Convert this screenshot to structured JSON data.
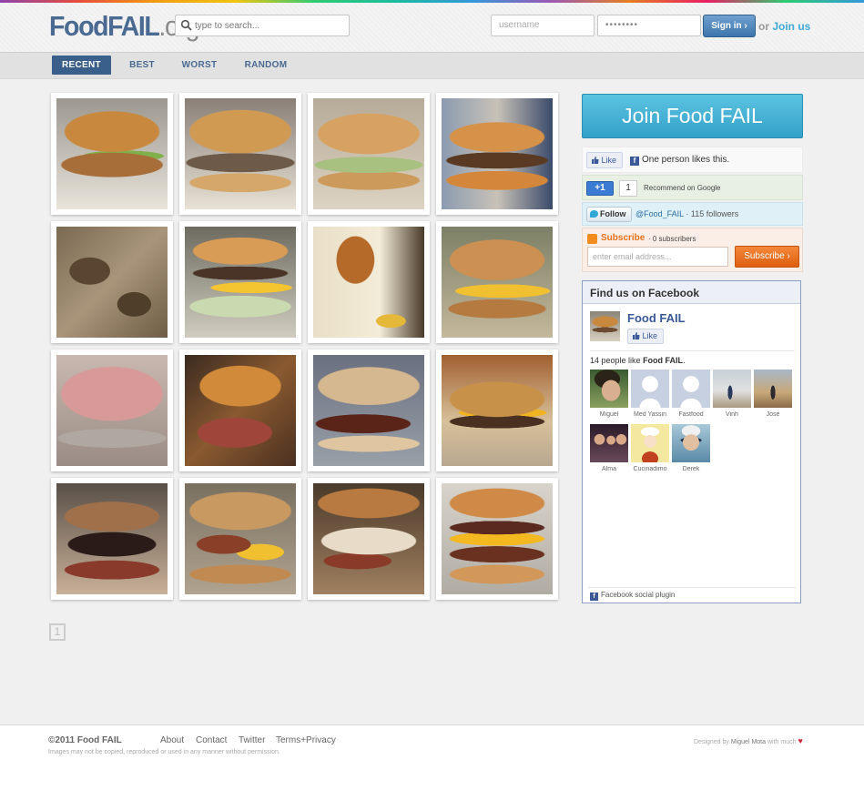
{
  "header": {
    "logo_main": "FoodFAIL",
    "logo_tld": ".org",
    "search_placeholder": "type to search...",
    "username_placeholder": "username",
    "password_value": "••••••••",
    "signin_label": "Sign in ›",
    "or_text": "or",
    "join_label": "Join us"
  },
  "nav": {
    "items": [
      {
        "label": "RECENT"
      },
      {
        "label": "BEST"
      },
      {
        "label": "WORST"
      },
      {
        "label": "RANDOM"
      }
    ]
  },
  "pager": {
    "current": "1"
  },
  "sidebar": {
    "join_label": "Join Food FAIL",
    "fb_like_label": "Like",
    "fb_like_text": "One person likes this.",
    "gplus_label": "+1",
    "gplus_count": "1",
    "gplus_text": "Recommend on Google",
    "twitter_label": "Follow",
    "twitter_handle": "@Food_FAIL",
    "twitter_followers": "· 115 followers",
    "subscribe_label": "Subscribe",
    "subscribe_count": "· 0 subscribers",
    "subscribe_placeholder": "enter email address...",
    "subscribe_button": "Subscribe ›",
    "facebook_box": {
      "title": "Find us on Facebook",
      "page_name": "Food FAIL",
      "like_label": "Like",
      "count_prefix": "14 people like",
      "count_page": "Food FAIL",
      "count_suffix": ".",
      "fans": [
        {
          "name": "Miguel"
        },
        {
          "name": "Med Yassin"
        },
        {
          "name": "Fastfood"
        },
        {
          "name": "Vinh"
        },
        {
          "name": "Jose"
        },
        {
          "name": "Alma"
        },
        {
          "name": "Cucinadimo"
        },
        {
          "name": "Derek"
        }
      ],
      "plugin_label": "Facebook social plugin"
    }
  },
  "footer": {
    "copyright": "©2011 Food FAIL",
    "links": [
      {
        "label": "About"
      },
      {
        "label": "Contact"
      },
      {
        "label": "Twitter"
      },
      {
        "label": "Terms+Privacy"
      }
    ],
    "disclaimer": "Images may not be copied, reproduced or used in any manner without permission.",
    "designed_prefix": "Designed by",
    "designer": "Miguel Mota",
    "designed_suffix": "with much",
    "heart": "♥"
  },
  "colors": {
    "brand_blue": "#4a6a92",
    "join_cyan": "#3fa9d6",
    "nav_active": "#3a5f8a",
    "subscribe_orange": "#e8721d"
  }
}
